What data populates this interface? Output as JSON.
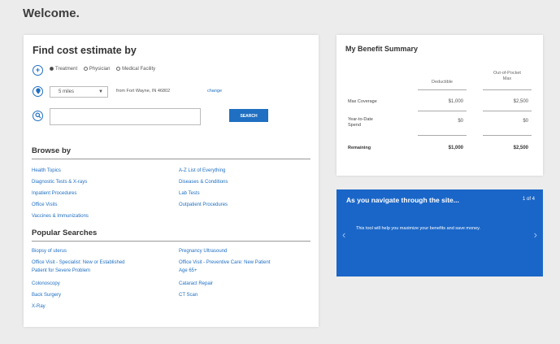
{
  "page": {
    "title": "Welcome."
  },
  "find": {
    "title": "Find cost estimate by",
    "options": [
      "Treatment",
      "Physician",
      "Medical Facility"
    ],
    "selected_option": "Treatment",
    "radius_value": "5 miles",
    "location_text": "from Fort Wayne, IN 46802",
    "change_label": "change",
    "search_value": "",
    "search_button": "SEARCH"
  },
  "browse": {
    "title": "Browse by",
    "left": [
      "Health Topics",
      "Diagnostic Tests & X-rays",
      "Inpatient Procedures",
      "Office Visits",
      "Vaccines & Immunizations"
    ],
    "right": [
      "A-Z List of Everything",
      "Diseases & Conditions",
      "Lab Tests",
      "Outpatient Procedures"
    ]
  },
  "popular": {
    "title": "Popular Searches",
    "left": [
      "Biopsy of uterus",
      "Office Visit - Specialist: New or Established",
      "Patient for Severe Problem",
      "Colonoscopy",
      "Back Surgery",
      "X-Ray"
    ],
    "right": [
      "Pregnancy Ultrasound",
      "Office Visit - Preventive Care: New Patient",
      "Age 65+",
      "Cataract Repair",
      "CT Scan"
    ]
  },
  "benefit": {
    "title": "My Benefit Summary",
    "col1": "Deductible",
    "col2_line1": "Out-of-Pocket",
    "col2_line2": "Max",
    "rows": [
      {
        "label": "Max Coverage",
        "label2": "",
        "v1": "$1,000",
        "v2": "$2,500"
      },
      {
        "label": "Year-to-Date",
        "label2": "Spend",
        "v1": "$0",
        "v2": "$0"
      },
      {
        "label": "Remaining",
        "label2": "",
        "v1": "$1,000",
        "v2": "$2,500"
      }
    ]
  },
  "promo": {
    "title": "As you navigate through the site...",
    "count": "1 of 4",
    "text": "This tool will help you maximize your benefits and save money.",
    "bg_color": "#1a66c8"
  }
}
